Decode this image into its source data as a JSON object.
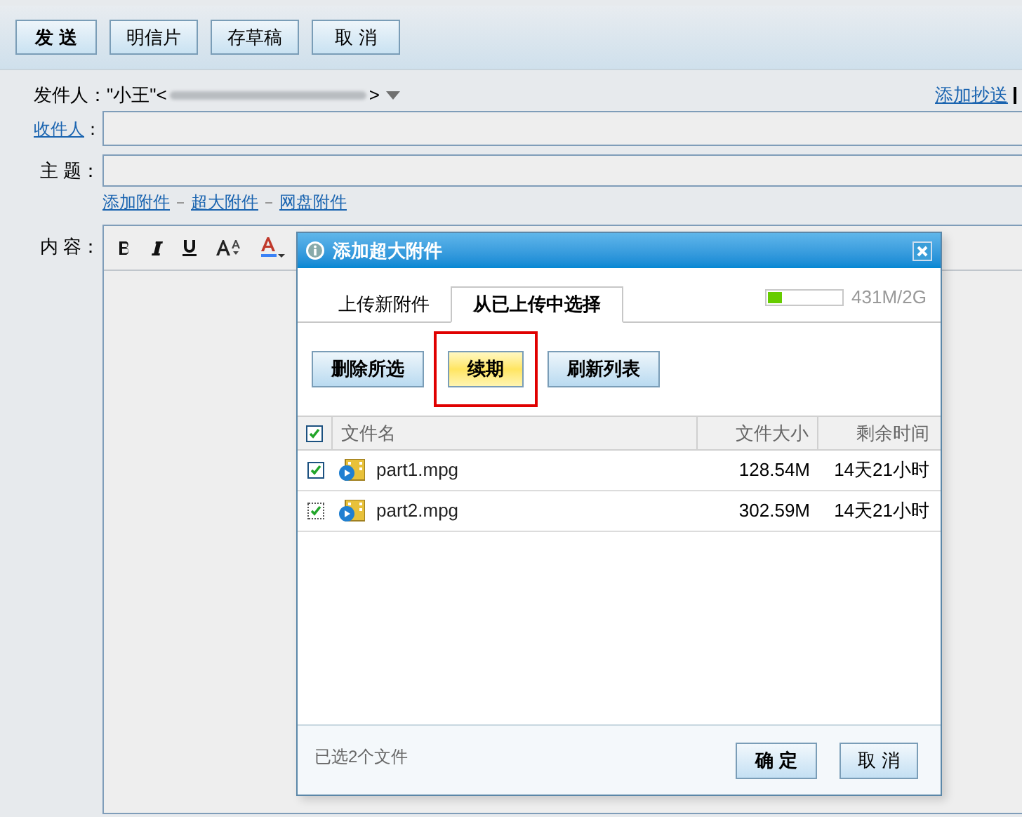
{
  "toolbar": {
    "buttons": [
      {
        "label": "发 送",
        "kind": "primary"
      },
      {
        "label": "明信片",
        "kind": "normal"
      },
      {
        "label": "存草稿",
        "kind": "normal"
      },
      {
        "label": "取 消",
        "kind": "normal"
      }
    ]
  },
  "sender": {
    "label": "发件人：",
    "name": "\"小王\"<",
    "suffix": ">"
  },
  "add_cc": "添加抄送",
  "recipient": {
    "label": "收件人",
    "suffix": "："
  },
  "subject": {
    "label": "主 题："
  },
  "attach_links": [
    "添加附件",
    "超大附件",
    "网盘附件"
  ],
  "content": {
    "label": "内 容："
  },
  "dialog": {
    "title": "添加超大附件",
    "tabs": [
      {
        "label": "上传新附件",
        "selected": false
      },
      {
        "label": "从已上传中选择",
        "selected": true
      }
    ],
    "quota": {
      "level": 0.21,
      "reading": "431M/2G"
    },
    "actions": [
      {
        "label": "删除所选",
        "highlighted": false
      },
      {
        "label": "续期",
        "highlighted": true
      },
      {
        "label": "刷新列表",
        "highlighted": false
      }
    ],
    "table": {
      "all_checked": true,
      "columns": [
        "文件名",
        "文件大小",
        "剩余时间"
      ],
      "rows": [
        {
          "checked": true,
          "name": "part1.mpg",
          "size": "128.54M",
          "remaining": "14天21小时"
        },
        {
          "checked": true,
          "name": "part2.mpg",
          "size": "302.59M",
          "remaining": "14天21小时"
        }
      ]
    },
    "summary": "已选2个文件",
    "buttons": [
      {
        "label": "确 定",
        "kind": "primary"
      },
      {
        "label": "取 消",
        "kind": "normal"
      }
    ]
  }
}
